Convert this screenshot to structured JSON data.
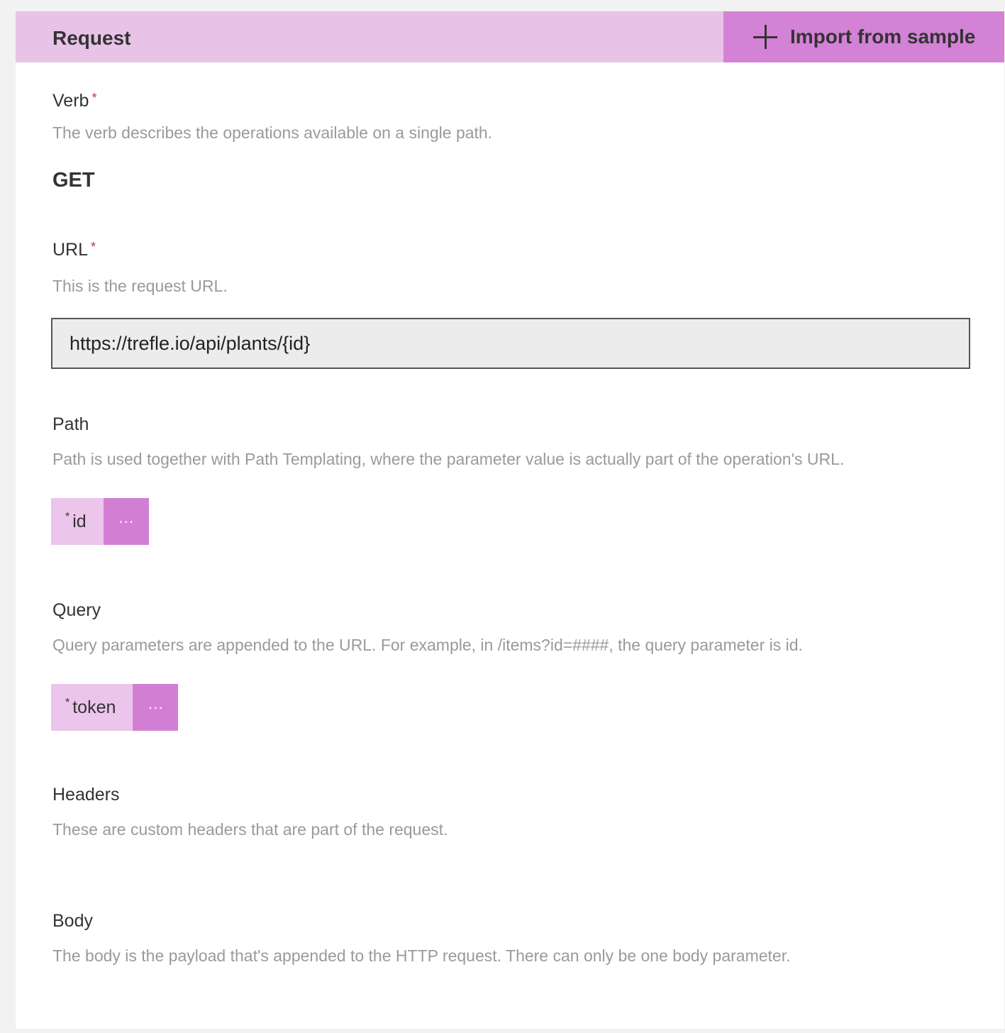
{
  "header": {
    "title": "Request",
    "import_label": "Import from sample"
  },
  "verb": {
    "label": "Verb",
    "required_mark": "*",
    "description": "The verb describes the operations available on a single path.",
    "value": "GET"
  },
  "url": {
    "label": "URL",
    "required_mark": "*",
    "description": "This is the request URL.",
    "value": "https://trefle.io/api/plants/{id}"
  },
  "path": {
    "label": "Path",
    "description": "Path is used together with Path Templating, where the parameter value is actually part of the operation's URL.",
    "params": [
      {
        "required_mark": "*",
        "name": "id",
        "more": "···"
      }
    ]
  },
  "query": {
    "label": "Query",
    "description": "Query parameters are appended to the URL. For example, in /items?id=####, the query parameter is id.",
    "params": [
      {
        "required_mark": "*",
        "name": "token",
        "more": "···"
      }
    ]
  },
  "headers": {
    "label": "Headers",
    "description": "These are custom headers that are part of the request."
  },
  "body": {
    "label": "Body",
    "description": "The body is the payload that's appended to the HTTP request. There can only be one body parameter."
  },
  "colors": {
    "header_bg": "#e8c3e8",
    "accent": "#d482d6",
    "chip_bg": "#ebc5eb"
  }
}
